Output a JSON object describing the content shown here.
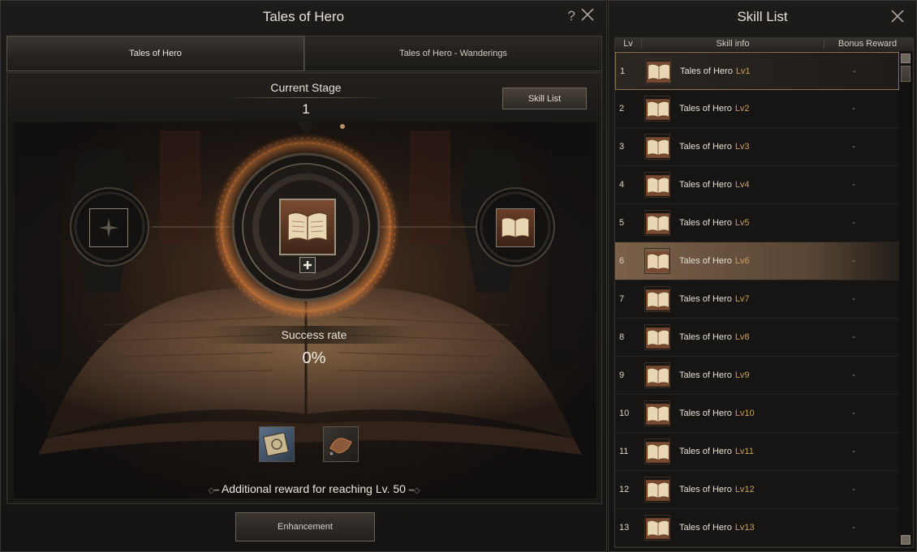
{
  "left_window": {
    "title": "Tales of Hero",
    "help_label": "?",
    "tabs": [
      {
        "label": "Tales of Hero",
        "active": true
      },
      {
        "label": "Tales of Hero - Wanderings",
        "active": false
      }
    ],
    "current_stage_label": "Current Stage",
    "current_stage_value": "1",
    "skill_list_button": "Skill List",
    "success_rate_label": "Success rate",
    "success_rate_value": "0%",
    "additional_reward": "Additional reward for reaching Lv. 50",
    "enhancement_button": "Enhancement",
    "icons": {
      "prev_slot": "compass-star-icon",
      "center_slot": "open-book-icon",
      "next_slot": "open-book-icon",
      "add": "plus-icon",
      "material_1": "rune-stone-icon",
      "material_2": "enhancement-stone-icon"
    }
  },
  "right_window": {
    "title": "Skill List",
    "columns": {
      "lv": "Lv",
      "info": "Skill info",
      "bonus": "Bonus Reward"
    },
    "rows": [
      {
        "lv": "1",
        "name": "Tales of Hero",
        "level_tag": "Lv1",
        "bonus": "-",
        "state": "selected"
      },
      {
        "lv": "2",
        "name": "Tales of Hero",
        "level_tag": "Lv2",
        "bonus": "-",
        "state": ""
      },
      {
        "lv": "3",
        "name": "Tales of Hero",
        "level_tag": "Lv3",
        "bonus": "-",
        "state": ""
      },
      {
        "lv": "4",
        "name": "Tales of Hero",
        "level_tag": "Lv4",
        "bonus": "-",
        "state": ""
      },
      {
        "lv": "5",
        "name": "Tales of Hero",
        "level_tag": "Lv5",
        "bonus": "-",
        "state": ""
      },
      {
        "lv": "6",
        "name": "Tales of Hero",
        "level_tag": "Lv6",
        "bonus": "-",
        "state": "highlighted"
      },
      {
        "lv": "7",
        "name": "Tales of Hero",
        "level_tag": "Lv7",
        "bonus": "-",
        "state": ""
      },
      {
        "lv": "8",
        "name": "Tales of Hero",
        "level_tag": "Lv8",
        "bonus": "-",
        "state": ""
      },
      {
        "lv": "9",
        "name": "Tales of Hero",
        "level_tag": "Lv9",
        "bonus": "-",
        "state": ""
      },
      {
        "lv": "10",
        "name": "Tales of Hero",
        "level_tag": "Lv10",
        "bonus": "-",
        "state": ""
      },
      {
        "lv": "11",
        "name": "Tales of Hero",
        "level_tag": "Lv11",
        "bonus": "-",
        "state": ""
      },
      {
        "lv": "12",
        "name": "Tales of Hero",
        "level_tag": "Lv12",
        "bonus": "-",
        "state": ""
      },
      {
        "lv": "13",
        "name": "Tales of Hero",
        "level_tag": "Lv13",
        "bonus": "-",
        "state": ""
      }
    ]
  },
  "colors": {
    "accent_gold": "#c8a060",
    "glow_orange": "#e07830",
    "panel_bg": "#1a1815"
  }
}
